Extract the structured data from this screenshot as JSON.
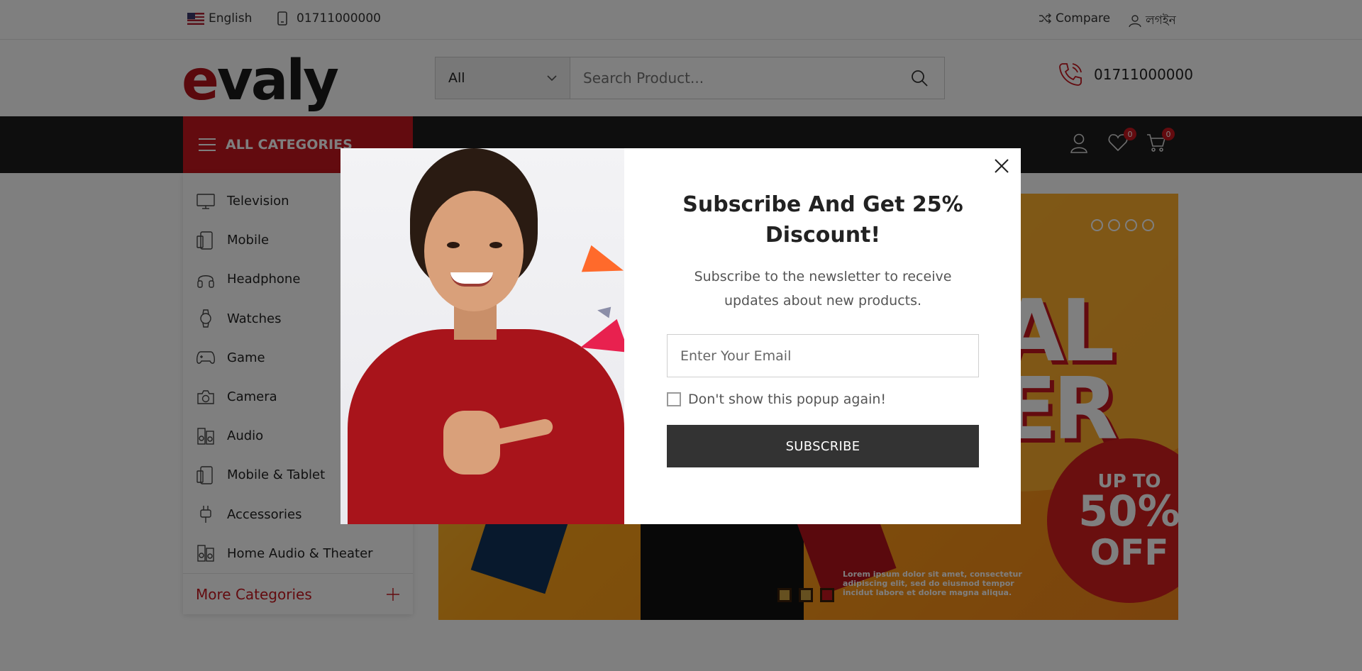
{
  "topbar": {
    "language": "English",
    "phone": "01711000000",
    "compare": "Compare",
    "login": "লগইন"
  },
  "header": {
    "logo_e": "e",
    "logo_rest": "valy",
    "search_category": "All",
    "search_placeholder": "Search Product...",
    "hotline": "01711000000"
  },
  "navbar": {
    "all_categories": "ALL CATEGORIES",
    "wishlist_count": "0",
    "cart_count": "0"
  },
  "sidebar": {
    "items": [
      {
        "label": "Television",
        "icon": "tv-icon"
      },
      {
        "label": "Mobile",
        "icon": "mobile-icon"
      },
      {
        "label": "Headphone",
        "icon": "headphone-icon"
      },
      {
        "label": "Watches",
        "icon": "watch-icon"
      },
      {
        "label": "Game",
        "icon": "gamepad-icon"
      },
      {
        "label": "Camera",
        "icon": "camera-icon"
      },
      {
        "label": "Audio",
        "icon": "speaker-icon"
      },
      {
        "label": "Mobile & Tablet",
        "icon": "tablet-icon"
      },
      {
        "label": "Accessories",
        "icon": "plug-icon"
      },
      {
        "label": "Home Audio & Theater",
        "icon": "speaker-icon"
      }
    ],
    "more_categories": "More Categories"
  },
  "banner": {
    "big_text": "AL\nER",
    "up_to": "UP TO",
    "percent": "50%",
    "off": "OFF",
    "lorem": "Lorem ipsum dolor sit amet, consectetur adipiscing elit, sed do eiusmod tempor incidut labore et dolore magna aliqua.",
    "slides": 3,
    "active_slide": 3
  },
  "modal": {
    "title": "Subscribe And Get 25% Discount!",
    "description": "Subscribe to the newsletter to receive updates about new products.",
    "email_placeholder": "Enter Your Email",
    "dont_show": "Don't show this popup again!",
    "subscribe": "SUBSCRIBE"
  },
  "colors": {
    "brand_red": "#c6161e",
    "nav_dark": "#1d1d1d",
    "button_dark": "#333333"
  }
}
